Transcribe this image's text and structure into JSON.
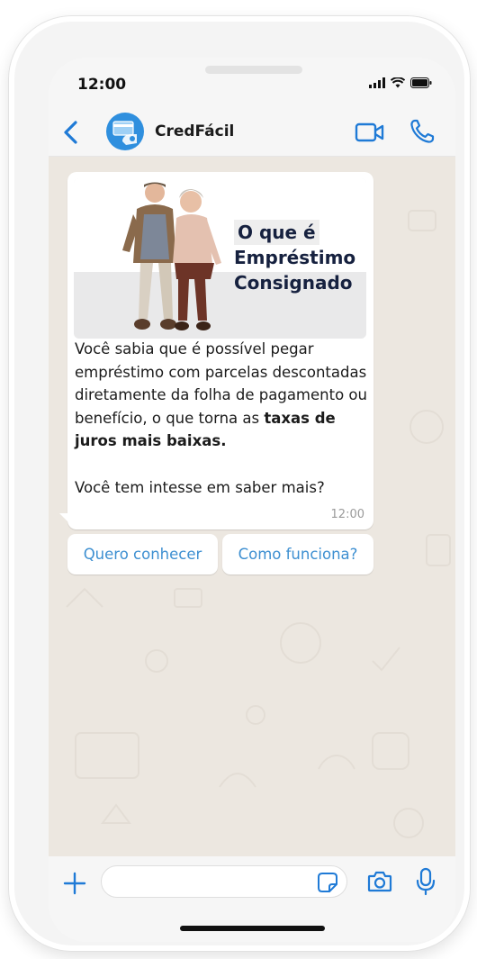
{
  "status_bar": {
    "time": "12:00"
  },
  "header": {
    "contact_name": "CredFácil"
  },
  "message": {
    "image_title_lines": [
      "O que é",
      "Empréstimo",
      "Consignado"
    ],
    "text_part1": "Você sabia que é possível pegar empréstimo com parcelas descontadas diretamente da folha de pagamento ou benefício, o que  torna as ",
    "text_bold": "taxas de juros mais baixas.",
    "text_part2": "Você tem intesse em saber mais?",
    "time": "12:00"
  },
  "quick_replies": [
    "Quero conhecer",
    "Como funciona?"
  ],
  "icons": {
    "back": "chevron-left-icon",
    "video": "video-camera-icon",
    "call": "phone-icon",
    "plus": "plus-icon",
    "sticker": "sticker-icon",
    "camera": "camera-icon",
    "mic": "microphone-icon"
  },
  "colors": {
    "accent": "#1f7ad6",
    "quick_reply_text": "#3d8fd1",
    "chat_bg": "#ece7e0",
    "avatar": "#2f8fde"
  }
}
